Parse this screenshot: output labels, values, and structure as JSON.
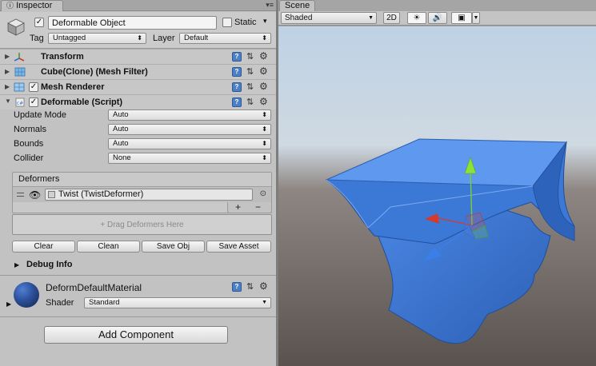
{
  "inspector": {
    "tab_label": "Inspector",
    "tab_menu": "▾≡",
    "object": {
      "active_check": "✓",
      "name": "Deformable Object",
      "static_label": "Static",
      "tag_label": "Tag",
      "tag_value": "Untagged",
      "layer_label": "Layer",
      "layer_value": "Default"
    },
    "components": [
      {
        "title": "Transform"
      },
      {
        "title": "Cube(Clone) (Mesh Filter)"
      },
      {
        "title": "Mesh Renderer",
        "enabled_check": "✓"
      },
      {
        "title": "Deformable (Script)",
        "enabled_check": "✓"
      }
    ],
    "properties": [
      {
        "label": "Update Mode",
        "value": "Auto"
      },
      {
        "label": "Normals",
        "value": "Auto"
      },
      {
        "label": "Bounds",
        "value": "Auto"
      },
      {
        "label": "Collider",
        "value": "None"
      }
    ],
    "deformers": {
      "title": "Deformers",
      "item": "Twist (TwistDeformer)",
      "add": "+",
      "remove": "−",
      "drop_hint": "+ Drag Deformers Here"
    },
    "buttons": {
      "clear": "Clear",
      "clean": "Clean",
      "save_obj": "Save Obj",
      "save_asset": "Save Asset"
    },
    "debug_info": "Debug Info",
    "material": {
      "name": "DeformDefaultMaterial",
      "shader_label": "Shader",
      "shader_value": "Standard"
    },
    "add_component": "Add Component",
    "help_glyph": "?",
    "preset_glyph": "⇅",
    "gear_glyph": "⚙"
  },
  "scene": {
    "tab_label": "Scene",
    "draw_mode": "Shaded",
    "toggle_2d": "2D",
    "lighting_glyph": "☀",
    "audio_glyph": "🔊",
    "effects_glyph": "▣"
  },
  "colors": {
    "mesh_top": "#5e98f2",
    "mesh_side": "#3f7ee0",
    "mesh_dark": "#2d62b8",
    "axis_x": "#d63a2a",
    "axis_y": "#7ad12e",
    "axis_z": "#3a7ee8",
    "sky": "#c8d8e6",
    "ground": "#5c5450"
  }
}
